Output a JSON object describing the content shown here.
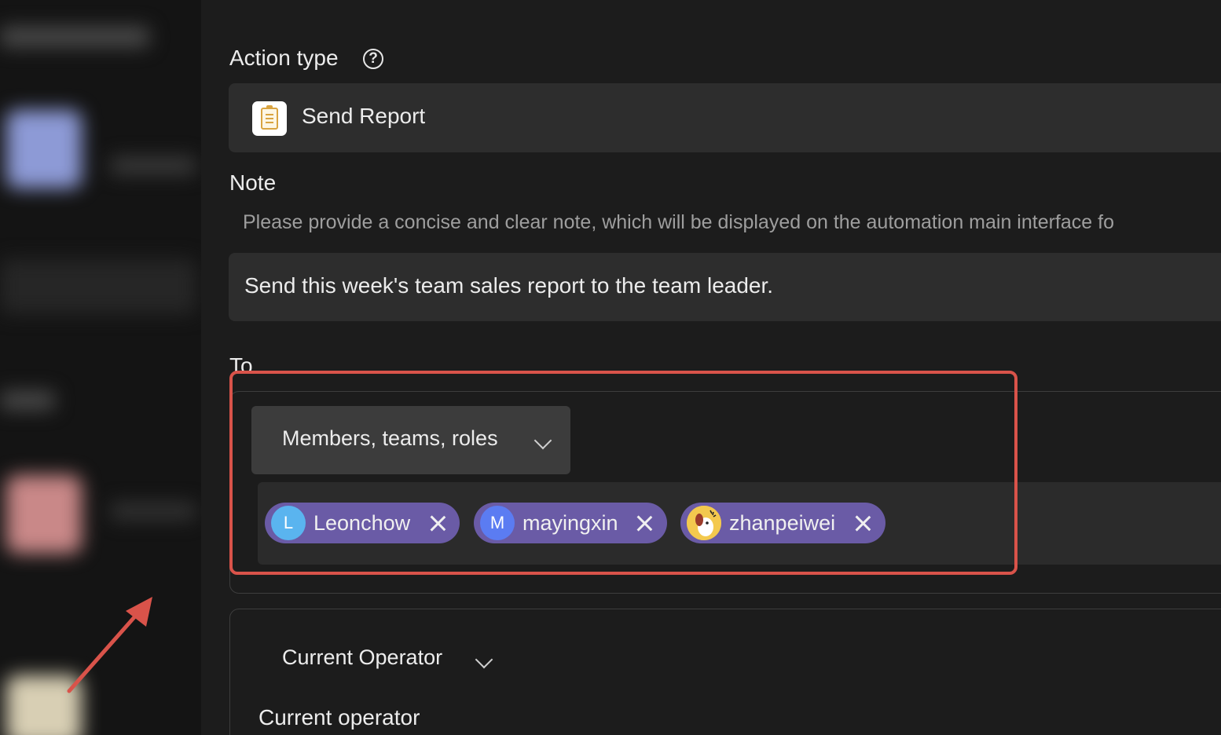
{
  "action_type": {
    "label": "Action type",
    "help_icon": "question-circle-icon",
    "value": "Send Report",
    "value_icon": "report-clipboard-icon"
  },
  "note": {
    "label": "Note",
    "hint": "Please provide a concise and clear note, which will be displayed on the automation main interface fo",
    "value": "Send this week's team sales report to the team leader."
  },
  "to": {
    "label": "To",
    "dropdown_label": "Members, teams, roles",
    "recipients": [
      {
        "name": "Leonchow",
        "initial": "L",
        "avatar_color": "#5ab4ef"
      },
      {
        "name": "mayingxin",
        "initial": "M",
        "avatar_color": "#5b7cf2"
      },
      {
        "name": "zhanpeiwei",
        "initial": "",
        "avatar_color": "#f3c94e"
      }
    ]
  },
  "current_operator": {
    "dropdown_label": "Current Operator",
    "label": "Current operator"
  },
  "colors": {
    "background": "#1c1c1c",
    "field": "#2d2d2d",
    "chip": "#6a5ba6",
    "highlight": "#d9534a"
  }
}
